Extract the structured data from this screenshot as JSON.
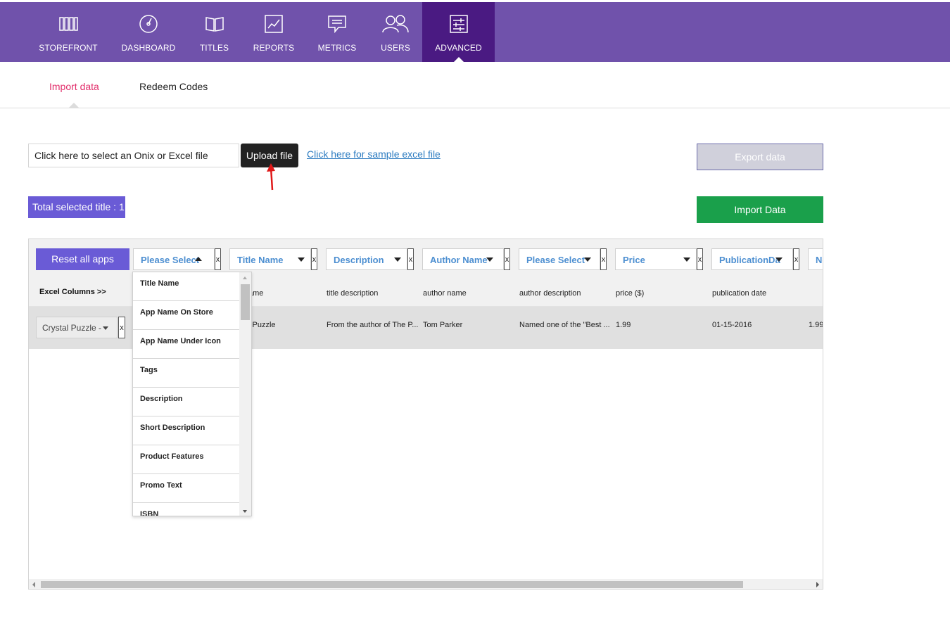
{
  "nav": {
    "items": [
      {
        "label": "STOREFRONT",
        "icon": "storefront-icon"
      },
      {
        "label": "DASHBOARD",
        "icon": "dashboard-icon"
      },
      {
        "label": "TITLES",
        "icon": "titles-icon"
      },
      {
        "label": "REPORTS",
        "icon": "reports-icon"
      },
      {
        "label": "METRICS",
        "icon": "metrics-icon"
      },
      {
        "label": "USERS",
        "icon": "users-icon"
      },
      {
        "label": "ADVANCED",
        "icon": "advanced-icon"
      }
    ],
    "active": "ADVANCED",
    "bg_color": "#7052ab",
    "active_color": "#4a1a82"
  },
  "subtabs": {
    "import_data": "Import data",
    "redeem_codes": "Redeem Codes",
    "active": "Import data"
  },
  "upload": {
    "file_placeholder": "Click here to select an Onix or Excel file",
    "upload_label": "Upload file",
    "sample_link": "Click here for sample excel file"
  },
  "actions": {
    "export_label": "Export data",
    "import_label": "Import Data",
    "total_selected": "Total selected title : 1"
  },
  "table": {
    "reset_label": "Reset all apps",
    "excel_columns_label": "Excel Columns >>",
    "column_selects": [
      {
        "label": "Please Select",
        "open": true
      },
      {
        "label": "Title Name"
      },
      {
        "label": "Description"
      },
      {
        "label": "Author Name"
      },
      {
        "label": "Please Select"
      },
      {
        "label": "Price"
      },
      {
        "label": "PublicationDa"
      },
      {
        "label": "Ne"
      }
    ],
    "x_label": "x",
    "column_headers": [
      "ame",
      "title description",
      "author name",
      "author description",
      "price ($)",
      "publication date"
    ],
    "row": {
      "app_select": "Crystal Puzzle -",
      "cells": [
        "l Puzzle",
        "From the author of The P...",
        "Tom Parker",
        "Named one of the \"Best ...",
        "1.99",
        "01-15-2016",
        "1.99"
      ]
    }
  },
  "dropdown": {
    "options": [
      "Title Name",
      "App Name On Store",
      "App Name Under Icon",
      "Tags",
      "Description",
      "Short Description",
      "Product Features",
      "Promo Text",
      "ISBN"
    ]
  }
}
